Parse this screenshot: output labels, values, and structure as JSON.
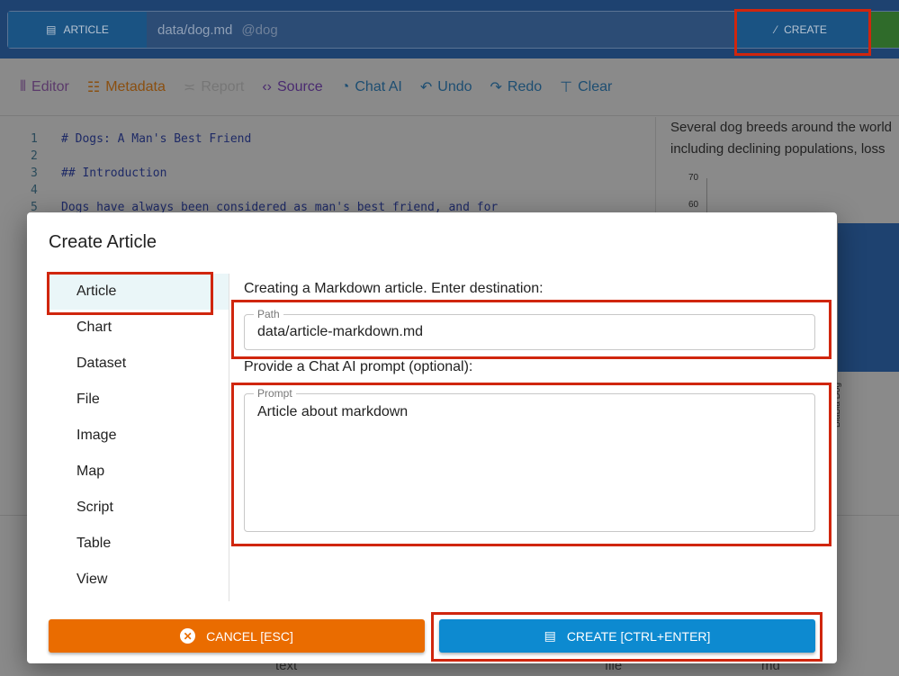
{
  "topbar": {
    "article_label": "ARTICLE",
    "path": "data/dog.md",
    "alias": "@dog",
    "create_label": "CREATE"
  },
  "toolbar": {
    "items": [
      {
        "label": "Editor",
        "icon": "editor-icon",
        "color": "#5b3a6b"
      },
      {
        "label": "Metadata",
        "icon": "sliders-icon",
        "color": "#8a4f10"
      },
      {
        "label": "Report",
        "icon": "report-icon",
        "color": "#767676"
      },
      {
        "label": "Source",
        "icon": "code-icon",
        "color": "#4a2a70"
      },
      {
        "label": "Chat AI",
        "icon": "chat-ai-icon",
        "color": "#1d4e72"
      },
      {
        "label": "Undo",
        "icon": "undo-icon",
        "color": "#1d4e72"
      },
      {
        "label": "Redo",
        "icon": "redo-icon",
        "color": "#1d4e72"
      },
      {
        "label": "Clear",
        "icon": "clear-format-icon",
        "color": "#1d4e72"
      }
    ]
  },
  "editor": {
    "lines": [
      {
        "n": "1",
        "text": "# Dogs: A Man's Best Friend"
      },
      {
        "n": "2",
        "text": ""
      },
      {
        "n": "3",
        "text": "## Introduction"
      },
      {
        "n": "4",
        "text": ""
      },
      {
        "n": "5",
        "text": "Dogs have always been considered as man's best friend, and for"
      }
    ]
  },
  "preview": {
    "text1": "Several dog breeds around the world",
    "text2": "including declining populations, loss",
    "y_ticks": [
      "70",
      "60"
    ],
    "bar_label": "BlaBla Dog"
  },
  "bottom": {
    "fields": [
      "text",
      "file",
      "md"
    ]
  },
  "modal": {
    "title": "Create Article",
    "types": [
      "Article",
      "Chart",
      "Dataset",
      "File",
      "Image",
      "Map",
      "Script",
      "Table",
      "View"
    ],
    "selected": "Article",
    "destination_label": "Creating a Markdown article. Enter destination:",
    "path_label": "Path",
    "path_value": "data/article-markdown.md",
    "prompt_intro": "Provide a Chat AI prompt (optional):",
    "prompt_label": "Prompt",
    "prompt_value": "Article about markdown",
    "cancel_label": "CANCEL [ESC]",
    "create_label": "CREATE [CTRL+ENTER]",
    "colors": {
      "cancel": "#ea6c00",
      "create": "#0d8ad0",
      "highlight": "#d0260e"
    }
  }
}
